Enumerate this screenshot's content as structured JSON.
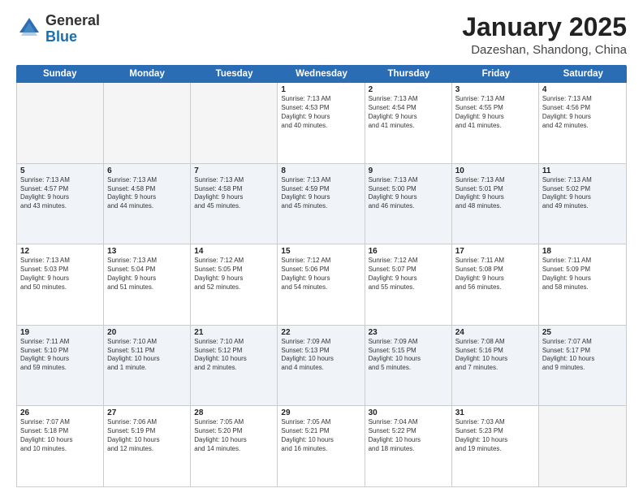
{
  "logo": {
    "general": "General",
    "blue": "Blue"
  },
  "title": "January 2025",
  "location": "Dazeshan, Shandong, China",
  "weekdays": [
    "Sunday",
    "Monday",
    "Tuesday",
    "Wednesday",
    "Thursday",
    "Friday",
    "Saturday"
  ],
  "weeks": [
    [
      {
        "day": "",
        "info": ""
      },
      {
        "day": "",
        "info": ""
      },
      {
        "day": "",
        "info": ""
      },
      {
        "day": "1",
        "info": "Sunrise: 7:13 AM\nSunset: 4:53 PM\nDaylight: 9 hours\nand 40 minutes."
      },
      {
        "day": "2",
        "info": "Sunrise: 7:13 AM\nSunset: 4:54 PM\nDaylight: 9 hours\nand 41 minutes."
      },
      {
        "day": "3",
        "info": "Sunrise: 7:13 AM\nSunset: 4:55 PM\nDaylight: 9 hours\nand 41 minutes."
      },
      {
        "day": "4",
        "info": "Sunrise: 7:13 AM\nSunset: 4:56 PM\nDaylight: 9 hours\nand 42 minutes."
      }
    ],
    [
      {
        "day": "5",
        "info": "Sunrise: 7:13 AM\nSunset: 4:57 PM\nDaylight: 9 hours\nand 43 minutes."
      },
      {
        "day": "6",
        "info": "Sunrise: 7:13 AM\nSunset: 4:58 PM\nDaylight: 9 hours\nand 44 minutes."
      },
      {
        "day": "7",
        "info": "Sunrise: 7:13 AM\nSunset: 4:58 PM\nDaylight: 9 hours\nand 45 minutes."
      },
      {
        "day": "8",
        "info": "Sunrise: 7:13 AM\nSunset: 4:59 PM\nDaylight: 9 hours\nand 45 minutes."
      },
      {
        "day": "9",
        "info": "Sunrise: 7:13 AM\nSunset: 5:00 PM\nDaylight: 9 hours\nand 46 minutes."
      },
      {
        "day": "10",
        "info": "Sunrise: 7:13 AM\nSunset: 5:01 PM\nDaylight: 9 hours\nand 48 minutes."
      },
      {
        "day": "11",
        "info": "Sunrise: 7:13 AM\nSunset: 5:02 PM\nDaylight: 9 hours\nand 49 minutes."
      }
    ],
    [
      {
        "day": "12",
        "info": "Sunrise: 7:13 AM\nSunset: 5:03 PM\nDaylight: 9 hours\nand 50 minutes."
      },
      {
        "day": "13",
        "info": "Sunrise: 7:13 AM\nSunset: 5:04 PM\nDaylight: 9 hours\nand 51 minutes."
      },
      {
        "day": "14",
        "info": "Sunrise: 7:12 AM\nSunset: 5:05 PM\nDaylight: 9 hours\nand 52 minutes."
      },
      {
        "day": "15",
        "info": "Sunrise: 7:12 AM\nSunset: 5:06 PM\nDaylight: 9 hours\nand 54 minutes."
      },
      {
        "day": "16",
        "info": "Sunrise: 7:12 AM\nSunset: 5:07 PM\nDaylight: 9 hours\nand 55 minutes."
      },
      {
        "day": "17",
        "info": "Sunrise: 7:11 AM\nSunset: 5:08 PM\nDaylight: 9 hours\nand 56 minutes."
      },
      {
        "day": "18",
        "info": "Sunrise: 7:11 AM\nSunset: 5:09 PM\nDaylight: 9 hours\nand 58 minutes."
      }
    ],
    [
      {
        "day": "19",
        "info": "Sunrise: 7:11 AM\nSunset: 5:10 PM\nDaylight: 9 hours\nand 59 minutes."
      },
      {
        "day": "20",
        "info": "Sunrise: 7:10 AM\nSunset: 5:11 PM\nDaylight: 10 hours\nand 1 minute."
      },
      {
        "day": "21",
        "info": "Sunrise: 7:10 AM\nSunset: 5:12 PM\nDaylight: 10 hours\nand 2 minutes."
      },
      {
        "day": "22",
        "info": "Sunrise: 7:09 AM\nSunset: 5:13 PM\nDaylight: 10 hours\nand 4 minutes."
      },
      {
        "day": "23",
        "info": "Sunrise: 7:09 AM\nSunset: 5:15 PM\nDaylight: 10 hours\nand 5 minutes."
      },
      {
        "day": "24",
        "info": "Sunrise: 7:08 AM\nSunset: 5:16 PM\nDaylight: 10 hours\nand 7 minutes."
      },
      {
        "day": "25",
        "info": "Sunrise: 7:07 AM\nSunset: 5:17 PM\nDaylight: 10 hours\nand 9 minutes."
      }
    ],
    [
      {
        "day": "26",
        "info": "Sunrise: 7:07 AM\nSunset: 5:18 PM\nDaylight: 10 hours\nand 10 minutes."
      },
      {
        "day": "27",
        "info": "Sunrise: 7:06 AM\nSunset: 5:19 PM\nDaylight: 10 hours\nand 12 minutes."
      },
      {
        "day": "28",
        "info": "Sunrise: 7:05 AM\nSunset: 5:20 PM\nDaylight: 10 hours\nand 14 minutes."
      },
      {
        "day": "29",
        "info": "Sunrise: 7:05 AM\nSunset: 5:21 PM\nDaylight: 10 hours\nand 16 minutes."
      },
      {
        "day": "30",
        "info": "Sunrise: 7:04 AM\nSunset: 5:22 PM\nDaylight: 10 hours\nand 18 minutes."
      },
      {
        "day": "31",
        "info": "Sunrise: 7:03 AM\nSunset: 5:23 PM\nDaylight: 10 hours\nand 19 minutes."
      },
      {
        "day": "",
        "info": ""
      }
    ]
  ]
}
